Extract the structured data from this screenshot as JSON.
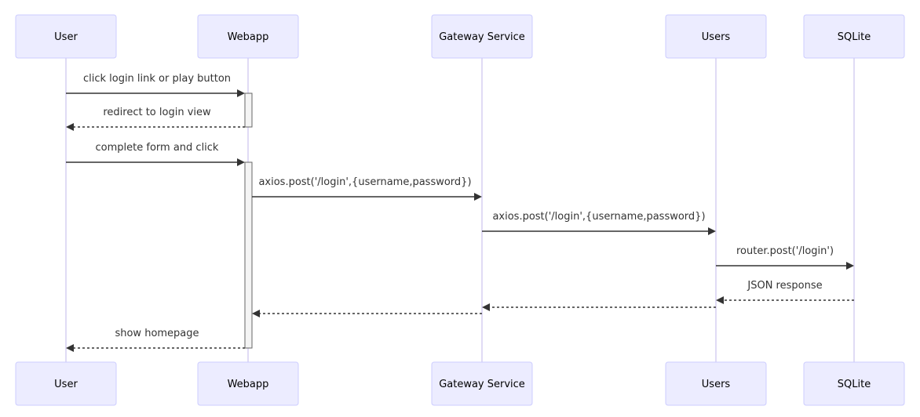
{
  "diagram": {
    "type": "sequence",
    "colors": {
      "actor_fill": "#ECECFF",
      "actor_stroke": "#CCCCFF",
      "lifeline": "#D5CFF2",
      "message": "#333333",
      "activation_fill": "#F4F4F4"
    },
    "actors": [
      {
        "id": "user",
        "label": "User"
      },
      {
        "id": "webapp",
        "label": "Webapp"
      },
      {
        "id": "gateway",
        "label": "Gateway Service"
      },
      {
        "id": "users",
        "label": "Users"
      },
      {
        "id": "sqlite",
        "label": "SQLite"
      }
    ],
    "messages": [
      {
        "from": "user",
        "to": "webapp",
        "label": "click login link or play button",
        "style": "solid"
      },
      {
        "from": "webapp",
        "to": "user",
        "label": "redirect to login view",
        "style": "dashed"
      },
      {
        "from": "user",
        "to": "webapp",
        "label": "complete form and click",
        "style": "solid"
      },
      {
        "from": "webapp",
        "to": "gateway",
        "label": "axios.post('/login',{username,password})",
        "style": "solid"
      },
      {
        "from": "gateway",
        "to": "users",
        "label": "axios.post('/login',{username,password})",
        "style": "solid"
      },
      {
        "from": "users",
        "to": "sqlite",
        "label": "router.post('/login')",
        "style": "solid"
      },
      {
        "from": "sqlite",
        "to": "users",
        "label": "JSON response",
        "style": "dashed"
      },
      {
        "from": "users",
        "to": "gateway",
        "label": "",
        "style": "dashed"
      },
      {
        "from": "gateway",
        "to": "webapp",
        "label": "",
        "style": "dashed"
      },
      {
        "from": "webapp",
        "to": "user",
        "label": "show homepage",
        "style": "dashed"
      }
    ],
    "activations": [
      {
        "actor": "webapp",
        "from_message": 0,
        "to_message": 1
      },
      {
        "actor": "webapp",
        "from_message": 2,
        "to_message": 9
      }
    ]
  }
}
